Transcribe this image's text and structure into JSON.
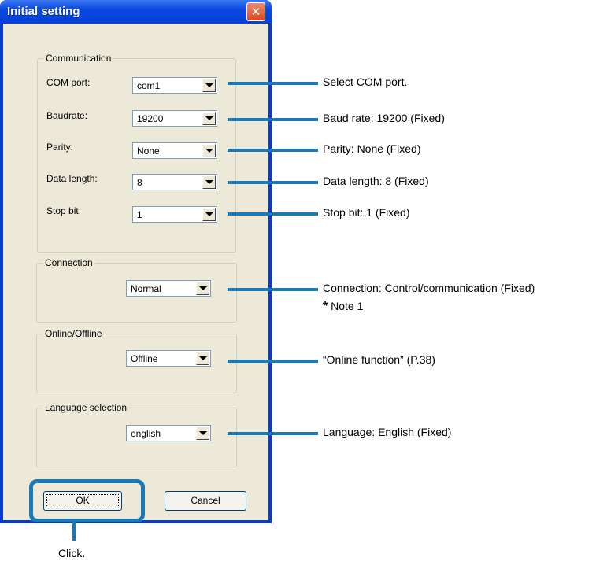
{
  "window": {
    "title": "Initial setting",
    "close_icon": "close-icon"
  },
  "communication": {
    "legend": "Communication",
    "rows": [
      {
        "label": "COM port:",
        "value": "com1"
      },
      {
        "label": "Baudrate:",
        "value": "19200"
      },
      {
        "label": "Parity:",
        "value": "None"
      },
      {
        "label": "Data length:",
        "value": "8"
      },
      {
        "label": "Stop bit:",
        "value": "1"
      }
    ]
  },
  "connection": {
    "legend": "Connection",
    "value": "Normal"
  },
  "online": {
    "legend": "Online/Offline",
    "value": "Offline"
  },
  "language": {
    "legend": "Language selection",
    "value": "english"
  },
  "buttons": {
    "ok": "OK",
    "cancel": "Cancel"
  },
  "annotations": {
    "com_port": "Select COM port.",
    "baud": "Baud rate: 19200 (Fixed)",
    "parity": "Parity: None (Fixed)",
    "data_length": "Data length: 8 (Fixed)",
    "stop_bit": "Stop bit: 1 (Fixed)",
    "connection": "Connection: Control/communication (Fixed)",
    "connection_note_mark": "*",
    "connection_note": "Note 1",
    "online": "“Online function” (P.38)",
    "language": "Language: English (Fixed)",
    "click": "Click."
  },
  "colors": {
    "accent": "#1a79b6",
    "dialog_bg": "#ece9d8",
    "titlebar": "#0a48e0"
  }
}
